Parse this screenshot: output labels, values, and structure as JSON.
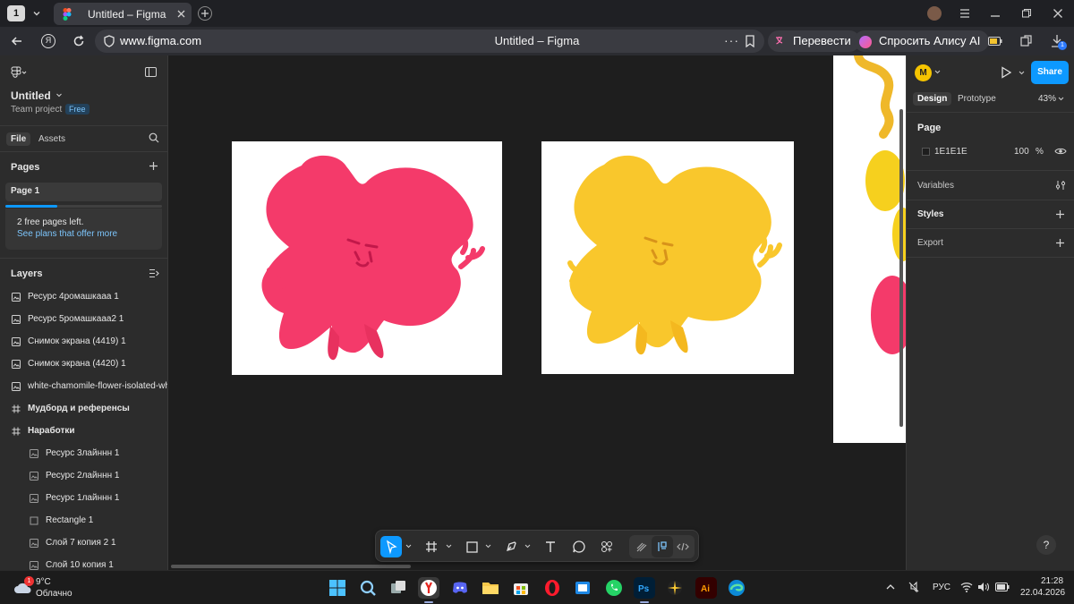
{
  "browser": {
    "tab_number": "1",
    "tab_title": "Untitled – Figma",
    "url": "www.figma.com",
    "page_title": "Untitled – Figma",
    "translate_label": "Перевести",
    "alice_label": "Спросить Алису AI",
    "downloads_badge": "1"
  },
  "figma": {
    "file_name": "Untitled",
    "team": "Team project",
    "plan_badge": "Free",
    "tabs": [
      "File",
      "Assets"
    ],
    "pages_header": "Pages",
    "current_page": "Page 1",
    "free_pages_note": "2 free pages left.",
    "see_plans_link": "See plans that offer more",
    "layers_header": "Layers",
    "layers": [
      {
        "name": "Ресурс 4ромашкааа 1",
        "type": "image",
        "indent": 0,
        "bold": false
      },
      {
        "name": "Ресурс 5ромашкааа2 1",
        "type": "image",
        "indent": 0,
        "bold": false
      },
      {
        "name": "Снимок экрана (4419) 1",
        "type": "image",
        "indent": 0,
        "bold": false
      },
      {
        "name": "Снимок экрана (4420) 1",
        "type": "image",
        "indent": 0,
        "bold": false
      },
      {
        "name": "white-chamomile-flower-isolated-whit",
        "type": "image",
        "indent": 0,
        "bold": false
      },
      {
        "name": "Мудборд и референсы",
        "type": "frame",
        "indent": 0,
        "bold": true
      },
      {
        "name": "Наработки",
        "type": "frame",
        "indent": 0,
        "bold": true
      },
      {
        "name": "Ресурс 3лайннн 1",
        "type": "image",
        "indent": 1,
        "bold": false
      },
      {
        "name": "Ресурс 2лайннн 1",
        "type": "image",
        "indent": 1,
        "bold": false
      },
      {
        "name": "Ресурс 1лайннн 1",
        "type": "image",
        "indent": 1,
        "bold": false
      },
      {
        "name": "Rectangle 1",
        "type": "rect",
        "indent": 1,
        "bold": false
      },
      {
        "name": "Слой 7 копия 2 1",
        "type": "image",
        "indent": 1,
        "bold": false
      },
      {
        "name": "Слой 10 копия 1",
        "type": "image",
        "indent": 1,
        "bold": false
      }
    ],
    "avatar_letter": "M",
    "share_label": "Share",
    "right_tabs": [
      "Design",
      "Prototype"
    ],
    "zoom": "43%",
    "page_section": "Page",
    "page_bg_hex": "1E1E1E",
    "page_bg_opacity": "100",
    "percent_sign": "%",
    "variables_label": "Variables",
    "styles_label": "Styles",
    "export_label": "Export",
    "help": "?"
  },
  "taskbar": {
    "weather_temp": "9°C",
    "weather_desc": "Облачно",
    "weather_badge": "1",
    "lang": "РУС",
    "time": "21:28",
    "date": "22.04.2026"
  },
  "colors": {
    "accent": "#0d99ff",
    "pink_flower": "#f43a6a",
    "yellow_flower": "#f9c72c",
    "canvas_bg": "#1e1e1e"
  }
}
